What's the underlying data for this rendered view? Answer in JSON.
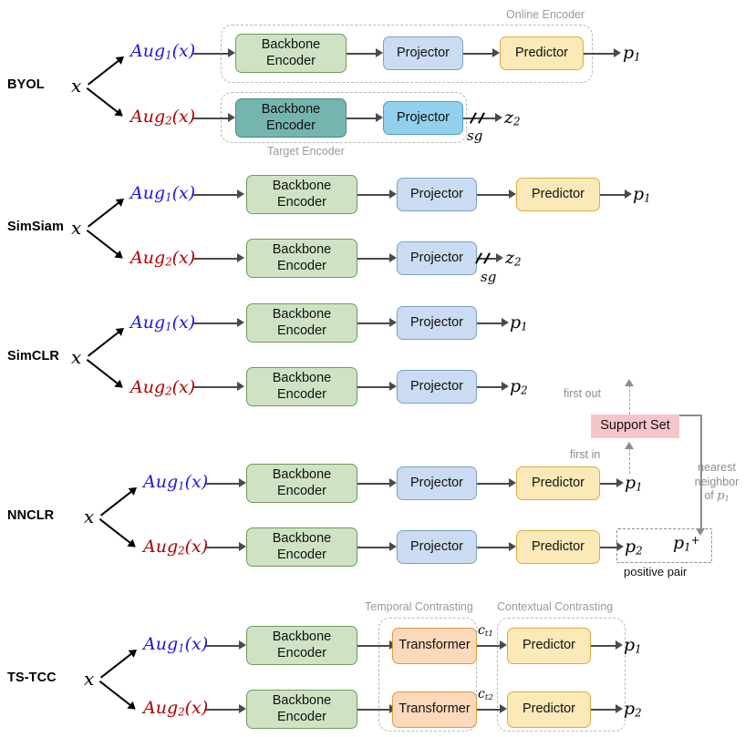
{
  "figure": {
    "type": "diagram",
    "description": "Comparison of self-supervised contrastive learning frameworks",
    "module_labels": {
      "backbone_encoder": "Backbone\nEncoder",
      "backbone_line1": "Backbone",
      "backbone_line2": "Encoder",
      "projector": "Projector",
      "predictor": "Predictor",
      "transformer": "Transformer",
      "support_set": "Support Set"
    },
    "colors": {
      "green": "#cfe3c4",
      "teal": "#75b5b0",
      "blue": "#cbdcf2",
      "blue_dark": "#93d0ee",
      "yellow": "#fbe9b8",
      "orange": "#fbd9ba",
      "pink": "#f6c5c8",
      "aug1_text": "#1a1ae0",
      "aug2_text": "#b00000",
      "group_dash": "#b9b9b9",
      "arrow": "#4a4a4a"
    }
  },
  "rows": {
    "byol": {
      "name": "BYOL",
      "input": "x",
      "aug1": "Aug",
      "aug1_sub": "1",
      "aug1_arg": "(x)",
      "aug2": "Aug",
      "aug2_sub": "2",
      "aug2_arg": "(x)",
      "group_online": "Online Encoder",
      "group_target": "Target Encoder",
      "out_top": "p",
      "out_top_sub": "1",
      "out_bottom": "z",
      "out_bottom_sub": "2",
      "stopgrad": "sg",
      "modules_top": [
        "Backbone Encoder",
        "Projector",
        "Predictor"
      ],
      "modules_bottom": [
        "Backbone Encoder",
        "Projector"
      ]
    },
    "simsiam": {
      "name": "SimSiam",
      "input": "x",
      "aug1": "Aug",
      "aug1_sub": "1",
      "aug1_arg": "(x)",
      "aug2": "Aug",
      "aug2_sub": "2",
      "aug2_arg": "(x)",
      "out_top": "p",
      "out_top_sub": "1",
      "out_bottom": "z",
      "out_bottom_sub": "2",
      "stopgrad": "sg",
      "modules_top": [
        "Backbone Encoder",
        "Projector",
        "Predictor"
      ],
      "modules_bottom": [
        "Backbone Encoder",
        "Projector"
      ]
    },
    "simclr": {
      "name": "SimCLR",
      "input": "x",
      "aug1": "Aug",
      "aug1_sub": "1",
      "aug1_arg": "(x)",
      "aug2": "Aug",
      "aug2_sub": "2",
      "aug2_arg": "(x)",
      "out_top": "p",
      "out_top_sub": "1",
      "out_bottom": "p",
      "out_bottom_sub": "2",
      "modules_top": [
        "Backbone Encoder",
        "Projector"
      ],
      "modules_bottom": [
        "Backbone Encoder",
        "Projector"
      ]
    },
    "nnclr": {
      "name": "NNCLR",
      "input": "x",
      "aug1": "Aug",
      "aug1_sub": "1",
      "aug1_arg": "(x)",
      "aug2": "Aug",
      "aug2_sub": "2",
      "aug2_arg": "(x)",
      "out_top": "p",
      "out_top_sub": "1",
      "out_bottom": "p",
      "out_bottom_sub": "2",
      "support_set": "Support Set",
      "first_out": "first out",
      "first_in": "first in",
      "nearest_neighbor": "nearest\nneighbor\nof",
      "nn_line1": "nearest",
      "nn_line2": "neighbor",
      "nn_line3": "of",
      "nn_symbol": "p",
      "nn_symbol_sub": "1",
      "positive_out": "p",
      "positive_out_sub": "1",
      "positive_out_sup": "+",
      "positive_pair": "positive pair",
      "modules_top": [
        "Backbone Encoder",
        "Projector",
        "Predictor"
      ],
      "modules_bottom": [
        "Backbone Encoder",
        "Projector",
        "Predictor"
      ]
    },
    "tstcc": {
      "name": "TS-TCC",
      "input": "x",
      "aug1": "Aug",
      "aug1_sub": "1",
      "aug1_arg": "(x)",
      "aug2": "Aug",
      "aug2_sub": "2",
      "aug2_arg": "(x)",
      "group_temporal": "Temporal Contrasting",
      "group_contextual": "Contextual Contrasting",
      "ct1": "c",
      "ct1_sub": "t1",
      "ct2": "c",
      "ct2_sub": "t2",
      "out_top": "p",
      "out_top_sub": "1",
      "out_bottom": "p",
      "out_bottom_sub": "2",
      "modules_top": [
        "Backbone Encoder",
        "Transformer",
        "Predictor"
      ],
      "modules_bottom": [
        "Backbone Encoder",
        "Transformer",
        "Predictor"
      ]
    }
  }
}
